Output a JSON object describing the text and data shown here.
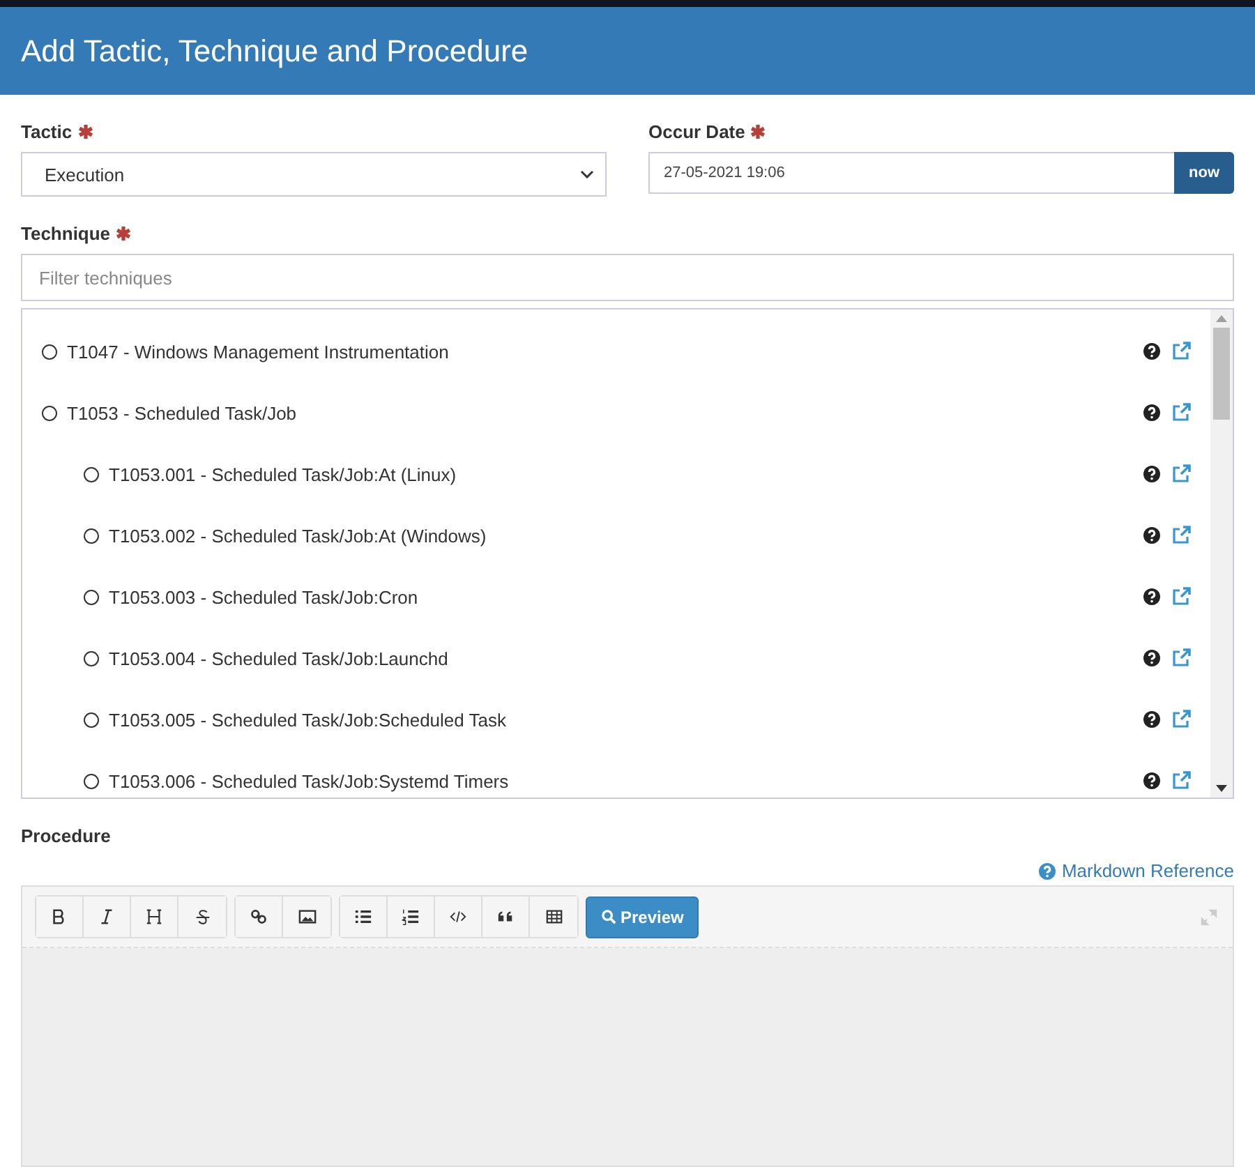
{
  "window": {
    "title": "Add Tactic, Technique and Procedure"
  },
  "tactic": {
    "label": "Tactic",
    "required": true,
    "value": "Execution"
  },
  "occur_date": {
    "label": "Occur Date",
    "required": true,
    "value": "27-05-2021 19:06",
    "button": "now"
  },
  "technique": {
    "label": "Technique",
    "required": true,
    "filter_placeholder": "Filter techniques",
    "items": [
      {
        "label": "T1047 - Windows Management Instrumentation",
        "selected": false
      },
      {
        "label": "T1053 - Scheduled Task/Job",
        "selected": false,
        "children": [
          {
            "label": "T1053.001 - Scheduled Task/Job:At (Linux)",
            "selected": false
          },
          {
            "label": "T1053.002 - Scheduled Task/Job:At (Windows)",
            "selected": false
          },
          {
            "label": "T1053.003 - Scheduled Task/Job:Cron",
            "selected": false
          },
          {
            "label": "T1053.004 - Scheduled Task/Job:Launchd",
            "selected": false
          },
          {
            "label": "T1053.005 - Scheduled Task/Job:Scheduled Task",
            "selected": false
          },
          {
            "label": "T1053.006 - Scheduled Task/Job:Systemd Timers",
            "selected": false
          }
        ]
      }
    ]
  },
  "procedure": {
    "label": "Procedure",
    "markdown_link": "Markdown Reference",
    "preview_button": "Preview",
    "toolbar": [
      {
        "buttons": [
          {
            "kind": "bold"
          },
          {
            "kind": "italic"
          },
          {
            "kind": "heading"
          },
          {
            "kind": "strike"
          }
        ]
      },
      {
        "buttons": [
          {
            "kind": "link"
          },
          {
            "kind": "image"
          }
        ]
      },
      {
        "buttons": [
          {
            "kind": "bullets"
          },
          {
            "kind": "numbers"
          },
          {
            "kind": "code"
          },
          {
            "kind": "quote"
          },
          {
            "kind": "table"
          }
        ]
      }
    ]
  }
}
